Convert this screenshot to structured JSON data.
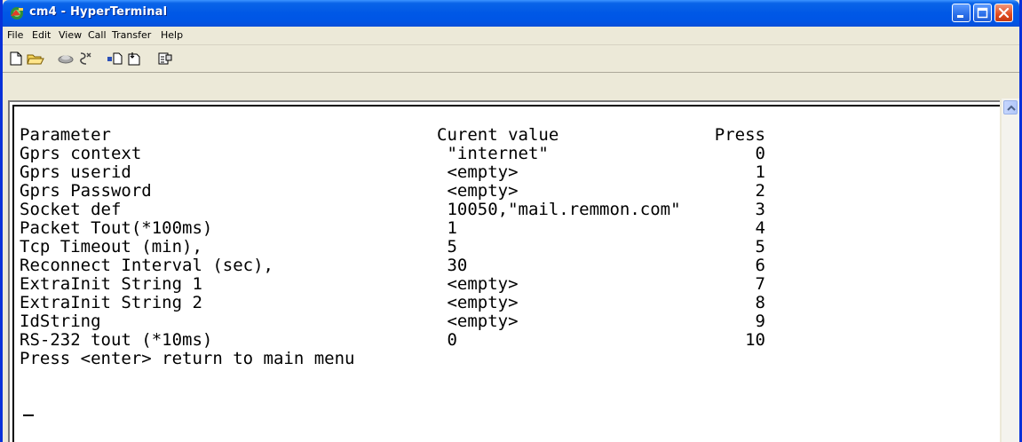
{
  "window": {
    "title": "cm4 - HyperTerminal"
  },
  "menu": {
    "items": [
      "File",
      "Edit",
      "View",
      "Call",
      "Transfer",
      "Help"
    ]
  },
  "toolbar": {
    "icons": [
      "new-document-icon",
      "open-folder-icon",
      "connect-icon",
      "disconnect-icon",
      "send-icon",
      "receive-icon",
      "properties-icon"
    ]
  },
  "terminal": {
    "header": {
      "parameter": "Parameter",
      "value": "Curent value",
      "press": "Press"
    },
    "rows": [
      {
        "parameter": "Gprs context",
        "value": " \"internet\"",
        "press": "0"
      },
      {
        "parameter": "Gprs userid",
        "value": " <empty>",
        "press": "1"
      },
      {
        "parameter": "Gprs Password",
        "value": " <empty>",
        "press": "2"
      },
      {
        "parameter": "Socket def",
        "value": " 10050,\"mail.remmon.com\"",
        "press": "3"
      },
      {
        "parameter": "Packet Tout(*100ms)",
        "value": " 1",
        "press": "4"
      },
      {
        "parameter": "Tcp Timeout (min),",
        "value": " 5",
        "press": "5"
      },
      {
        "parameter": "Reconnect Interval (sec),",
        "value": " 30",
        "press": "6"
      },
      {
        "parameter": "ExtraInit String 1",
        "value": " <empty>",
        "press": "7"
      },
      {
        "parameter": "ExtraInit String 2",
        "value": " <empty>",
        "press": "8"
      },
      {
        "parameter": "IdString",
        "value": " <empty>",
        "press": "9"
      },
      {
        "parameter": "RS-232 tout (*10ms)",
        "value": " 0",
        "press": "10"
      }
    ],
    "footer": "Press <enter> return to main menu",
    "cursor": "_"
  },
  "colors": {
    "titlebar": "#0058e6",
    "chrome": "#ece9d8",
    "terminal_bg": "#ffffff",
    "text": "#000000"
  }
}
